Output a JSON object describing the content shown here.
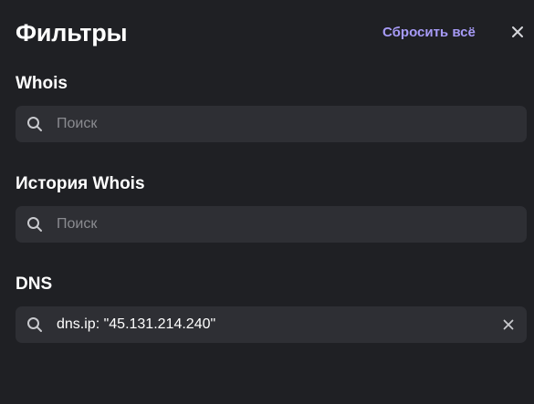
{
  "header": {
    "title": "Фильтры",
    "reset_label": "Сбросить всё",
    "close_icon": "close-icon"
  },
  "sections": [
    {
      "label": "Whois",
      "value": "",
      "placeholder": "Поиск"
    },
    {
      "label": "История Whois",
      "value": "",
      "placeholder": "Поиск"
    },
    {
      "label": "DNS",
      "value": "dns.ip: \"45.131.214.240\"",
      "placeholder": "Поиск",
      "clearable": true
    }
  ],
  "colors": {
    "background": "#1f2024",
    "field": "#2e2f34",
    "accent": "#a79bf7",
    "placeholder": "#8a8b90"
  }
}
